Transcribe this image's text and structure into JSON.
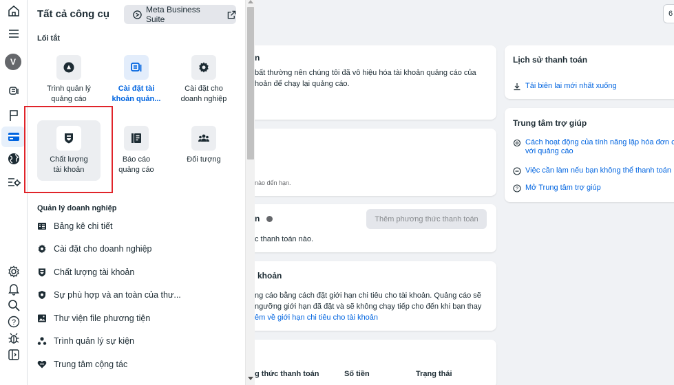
{
  "panel": {
    "title": "Tất cả công cụ",
    "meta_button": "Meta Business Suite",
    "shortcuts_heading": "Lối tắt",
    "shortcuts": [
      {
        "label": "Trình quản lý\nquảng cáo",
        "icon": "ads-manager-icon",
        "selected": false,
        "highlight": false
      },
      {
        "label": "Cài đặt tài\nkhoản quản...",
        "icon": "account-settings-icon",
        "selected": false,
        "highlight": true
      },
      {
        "label": "Cài đặt cho\ndoanh nghiệp",
        "icon": "gear-icon",
        "selected": false,
        "highlight": false
      },
      {
        "label": "Chất lượng\ntài khoản",
        "icon": "shield-icon",
        "selected": true,
        "highlight": false
      },
      {
        "label": "Báo cáo\nquảng cáo",
        "icon": "report-icon",
        "selected": false,
        "highlight": false
      },
      {
        "label": "Đối tượng",
        "icon": "audience-icon",
        "selected": false,
        "highlight": false
      }
    ],
    "business_heading": "Quản lý doanh nghiệp",
    "menu": [
      {
        "label": "Bảng kê chi tiết",
        "icon": "statement-icon"
      },
      {
        "label": "Cài đặt cho doanh nghiệp",
        "icon": "gear-icon"
      },
      {
        "label": "Chất lượng tài khoản",
        "icon": "shield-icon"
      },
      {
        "label": "Sự phù hợp và an toàn của thư...",
        "icon": "brand-safety-icon"
      },
      {
        "label": "Thư viện file phương tiện",
        "icon": "media-library-icon"
      },
      {
        "label": "Trình quản lý sự kiện",
        "icon": "events-manager-icon"
      },
      {
        "label": "Trung tâm cộng tác",
        "icon": "collaboration-icon"
      }
    ]
  },
  "background": {
    "card1": {
      "title": "n",
      "line1": "bất thường nên chúng tôi đã vô hiệu hóa tài khoản quảng cáo của",
      "line2": "hoản để chạy lại quảng cáo."
    },
    "card2": {
      "note": "nào đến hạn."
    },
    "card3": {
      "title": "n",
      "text": "c thanh toán nào.",
      "button": "Thêm phương thức thanh toán"
    },
    "card4": {
      "title": "khoản",
      "line1": "ng cáo bằng cách đặt giới hạn chi tiêu cho tài khoản. Quảng cáo sẽ",
      "line2": "ngưỡng giới hạn đã đặt và sẽ không chạy tiếp cho đến khi bạn thay",
      "link": "êm về giới hạn chi tiêu cho tài khoản"
    },
    "table": {
      "col1": "g thức thanh toán",
      "col2": "Số tiền",
      "col3": "Trạng thái"
    },
    "history": {
      "title": "Lịch sử thanh toán",
      "link": "Tải biên lai mới nhất xuống"
    },
    "help": {
      "title": "Trung tâm trợ giúp",
      "item1_line1": "Cách hoạt động của tính năng lập hóa đơn c",
      "item1_line2": "với quảng cáo",
      "item2": "Việc cần làm nếu bạn không thể thanh toán",
      "item3": "Mở Trung tâm trợ giúp"
    },
    "corner_button": "6"
  },
  "rail": {
    "avatar_letter": "V"
  },
  "colors": {
    "accent": "#0064e0",
    "highlight_border": "#e0242a",
    "selected_tile": "#eceef1"
  }
}
